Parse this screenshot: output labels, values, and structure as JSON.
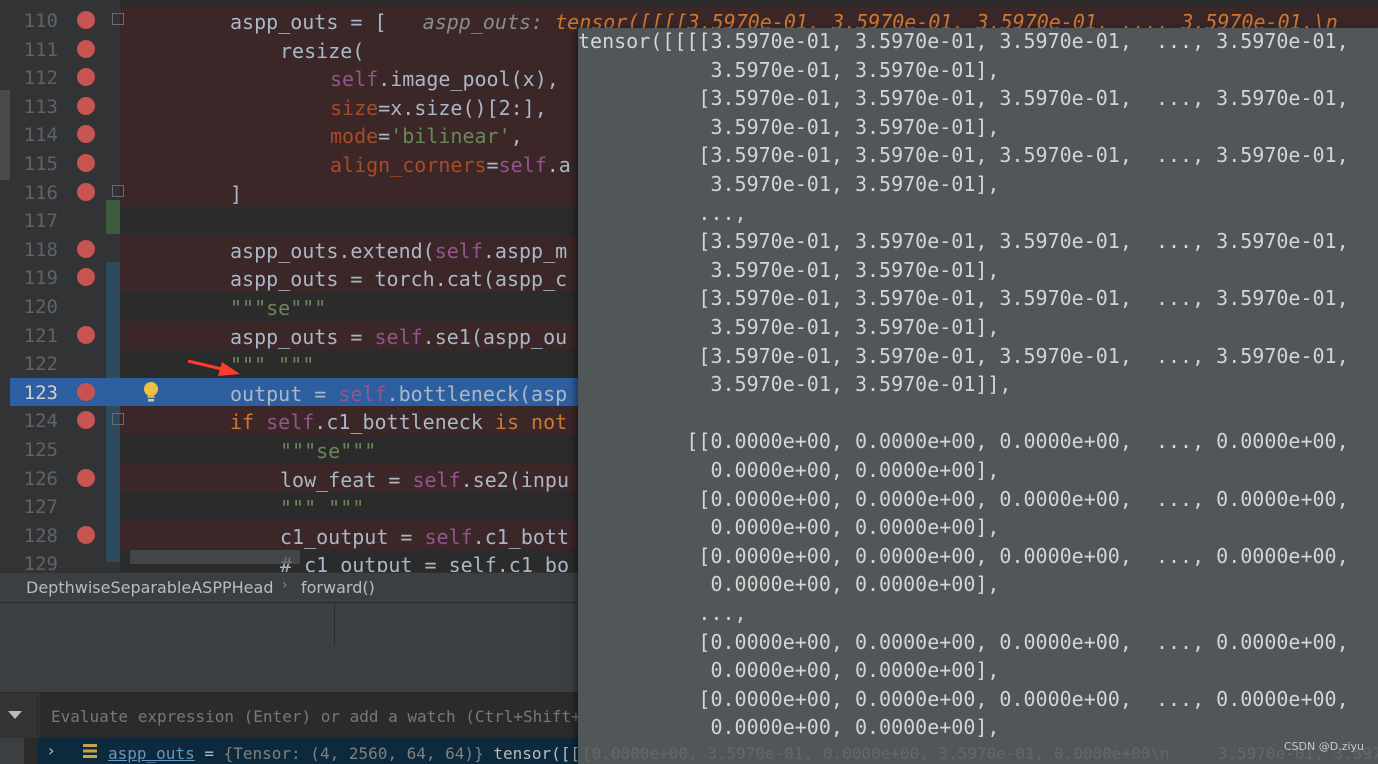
{
  "editor": {
    "lines": [
      {
        "num": "110",
        "bp": true,
        "fold": true,
        "indent": 230,
        "tokens": [
          [
            "vc",
            "aspp_outs = [   "
          ],
          [
            "hint-label",
            "aspp_outs: "
          ],
          [
            "hint-val",
            "tensor([[[[3.5970e-01, 3.5970e-01, 3.5970e-01, ..., 3.5970e-01,\\n"
          ]
        ]
      },
      {
        "num": "111",
        "bp": true,
        "indent": 280,
        "tokens": [
          [
            "vc",
            "resize("
          ]
        ]
      },
      {
        "num": "112",
        "bp": true,
        "indent": 330,
        "tokens": [
          [
            "self",
            "self"
          ],
          [
            "vc",
            ".image_pool(x),"
          ]
        ]
      },
      {
        "num": "113",
        "bp": true,
        "indent": 330,
        "tokens": [
          [
            "param",
            "size"
          ],
          [
            "vc",
            "=x.size()[2:],"
          ]
        ]
      },
      {
        "num": "114",
        "bp": true,
        "indent": 330,
        "tokens": [
          [
            "param",
            "mode"
          ],
          [
            "vc",
            "="
          ],
          [
            "str",
            "'bilinear'"
          ],
          [
            "vc",
            ","
          ]
        ]
      },
      {
        "num": "115",
        "bp": true,
        "indent": 330,
        "tokens": [
          [
            "param",
            "align_corners"
          ],
          [
            "vc",
            "="
          ],
          [
            "self",
            "self"
          ],
          [
            "vc",
            ".a"
          ]
        ]
      },
      {
        "num": "116",
        "bp": true,
        "fold": true,
        "indent": 230,
        "tokens": [
          [
            "vc",
            "]"
          ]
        ]
      },
      {
        "num": "117",
        "bp": false,
        "indent": 230,
        "tokens": []
      },
      {
        "num": "118",
        "bp": true,
        "indent": 230,
        "tokens": [
          [
            "vc",
            "aspp_outs.extend("
          ],
          [
            "self",
            "self"
          ],
          [
            "vc",
            ".aspp_m"
          ]
        ]
      },
      {
        "num": "119",
        "bp": true,
        "indent": 230,
        "tokens": [
          [
            "vc",
            "aspp_outs = torch.cat(aspp_c"
          ]
        ]
      },
      {
        "num": "120",
        "bp": false,
        "indent": 230,
        "tokens": [
          [
            "str",
            "\"\"\"se\"\"\""
          ]
        ]
      },
      {
        "num": "121",
        "bp": true,
        "indent": 230,
        "tokens": [
          [
            "vc",
            "aspp_outs = "
          ],
          [
            "self",
            "self"
          ],
          [
            "vc",
            ".se1(aspp_ou"
          ]
        ]
      },
      {
        "num": "122",
        "bp": false,
        "indent": 230,
        "tokens": [
          [
            "str",
            "\"\"\" \"\"\""
          ]
        ]
      },
      {
        "num": "123",
        "bp": true,
        "current": true,
        "bulb": true,
        "indent": 230,
        "tokens": [
          [
            "vc",
            "output = "
          ],
          [
            "self",
            "self"
          ],
          [
            "vc",
            ".bottleneck(asp"
          ]
        ]
      },
      {
        "num": "124",
        "bp": true,
        "fold": true,
        "indent": 230,
        "tokens": [
          [
            "kw",
            "if "
          ],
          [
            "self",
            "self"
          ],
          [
            "vc",
            ".c1_bottleneck "
          ],
          [
            "kw",
            "is not"
          ]
        ]
      },
      {
        "num": "125",
        "bp": false,
        "indent": 280,
        "tokens": [
          [
            "str",
            "\"\"\"se\"\"\""
          ]
        ]
      },
      {
        "num": "126",
        "bp": true,
        "indent": 280,
        "tokens": [
          [
            "vc",
            "low_feat = "
          ],
          [
            "self",
            "self"
          ],
          [
            "vc",
            ".se2(inpu"
          ]
        ]
      },
      {
        "num": "127",
        "bp": false,
        "indent": 280,
        "tokens": [
          [
            "str",
            "\"\"\" \"\"\""
          ]
        ]
      },
      {
        "num": "128",
        "bp": true,
        "indent": 280,
        "tokens": [
          [
            "vc",
            "c1_output = "
          ],
          [
            "self",
            "self"
          ],
          [
            "vc",
            ".c1_bott"
          ]
        ]
      },
      {
        "num": "129",
        "bp": false,
        "indent": 280,
        "tokens": [
          [
            "vc",
            "# c1_output = self.c1_bo"
          ]
        ]
      }
    ]
  },
  "breadcrumb": {
    "class_name": "DepthwiseSeparableASPPHead",
    "separator": "›",
    "method": "forward()"
  },
  "evaluate": {
    "placeholder": "Evaluate expression (Enter) or add a watch (Ctrl+Shift+E"
  },
  "variable": {
    "name": "aspp_outs",
    "eq": " = ",
    "type": "{Tensor: (4, 2560, 64, 64)} ",
    "value": "tensor([[[[3.5970e-01, 3.5970e-01, 3.5970e-01, ..., 3.5970e-01,\\n"
  },
  "popup": {
    "lines": [
      "tensor([[[[3.5970e-01, 3.5970e-01, 3.5970e-01,  ..., 3.5970e-01,",
      "           3.5970e-01, 3.5970e-01],",
      "          [3.5970e-01, 3.5970e-01, 3.5970e-01,  ..., 3.5970e-01,",
      "           3.5970e-01, 3.5970e-01],",
      "          [3.5970e-01, 3.5970e-01, 3.5970e-01,  ..., 3.5970e-01,",
      "           3.5970e-01, 3.5970e-01],",
      "          ...,",
      "          [3.5970e-01, 3.5970e-01, 3.5970e-01,  ..., 3.5970e-01,",
      "           3.5970e-01, 3.5970e-01],",
      "          [3.5970e-01, 3.5970e-01, 3.5970e-01,  ..., 3.5970e-01,",
      "           3.5970e-01, 3.5970e-01],",
      "          [3.5970e-01, 3.5970e-01, 3.5970e-01,  ..., 3.5970e-01,",
      "           3.5970e-01, 3.5970e-01]],",
      "",
      "         [[0.0000e+00, 0.0000e+00, 0.0000e+00,  ..., 0.0000e+00,",
      "           0.0000e+00, 0.0000e+00],",
      "          [0.0000e+00, 0.0000e+00, 0.0000e+00,  ..., 0.0000e+00,",
      "           0.0000e+00, 0.0000e+00],",
      "          [0.0000e+00, 0.0000e+00, 0.0000e+00,  ..., 0.0000e+00,",
      "           0.0000e+00, 0.0000e+00],",
      "          ...,",
      "          [0.0000e+00, 0.0000e+00, 0.0000e+00,  ..., 0.0000e+00,",
      "           0.0000e+00, 0.0000e+00],",
      "          [0.0000e+00, 0.0000e+00, 0.0000e+00,  ..., 0.0000e+00,",
      "           0.0000e+00, 0.0000e+00],"
    ],
    "bottom_fragment": "[0.0000e+00, 3.5970e-01, 0.0000e+00, 3.5970e-01, 0.0000e+00\\n     3.5970e-01, 3.5970"
  },
  "watermark": "CSDN @D.ziyu",
  "colors": {
    "breakpoint": "#c75450",
    "current_line": "#2d5fa0",
    "popup_bg": "#515658",
    "keyword": "#cc7832",
    "self": "#94558d",
    "string": "#6a8759"
  }
}
